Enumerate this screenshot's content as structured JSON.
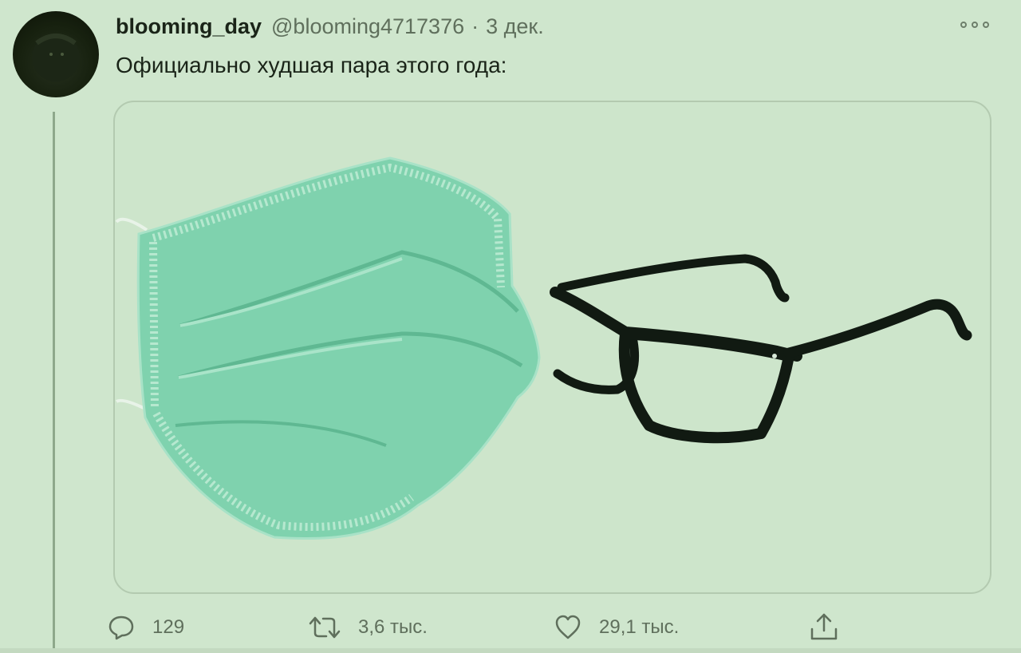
{
  "tweet": {
    "author_name": "blooming_day",
    "handle": "@blooming4717376",
    "separator": "·",
    "date": "3 дек.",
    "text": "Официально худшая пара этого года:",
    "media": {
      "items": [
        "surgical-mask",
        "eyeglasses"
      ]
    },
    "actions": {
      "reply_count": "129",
      "retweet_count": "3,6 тыс.",
      "like_count": "29,1 тыс."
    }
  },
  "icons": {
    "reply": "speech-bubble-icon",
    "retweet": "retweet-icon",
    "like": "heart-icon",
    "share": "share-icon",
    "more": "more-dots-icon"
  },
  "colors": {
    "background": "#cfe6cd",
    "text_primary": "#1a2418",
    "text_secondary": "#5f6f5c",
    "mask": "#7ed1ac",
    "glasses": "#111a12"
  }
}
